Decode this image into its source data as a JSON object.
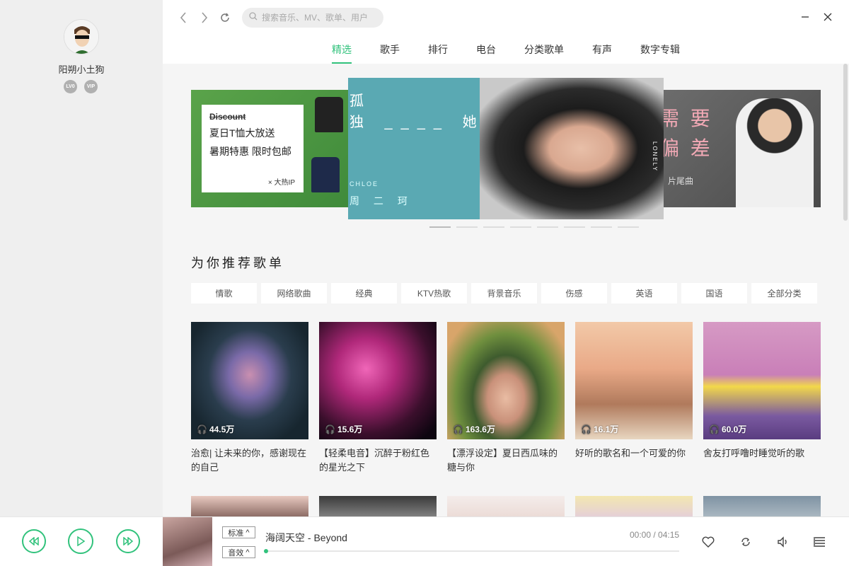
{
  "user": {
    "name": "阳朔小土狗",
    "badges": [
      "LV0",
      "VIP"
    ]
  },
  "search": {
    "placeholder": "搜索音乐、MV、歌单、用户"
  },
  "tabs": [
    "精选",
    "歌手",
    "排行",
    "电台",
    "分类歌单",
    "有声",
    "数字专辑"
  ],
  "active_tab": "精选",
  "banner": {
    "left": {
      "discount": "Discount",
      "line1": "夏日T恤大放送",
      "line2": "暑期特惠 限时包邮",
      "tag": "× 大热IP"
    },
    "center": {
      "title_line1": "孤",
      "title_line2": "独 ____ 她 呀",
      "artist_en": "CHLOE",
      "artist": "周 二 珂",
      "side_text": "LONELY"
    },
    "right": {
      "title_line1": "需 要",
      "title_line2": "偏 差",
      "sub": "》片尾曲"
    },
    "dot_count": 8,
    "active_dot": 0
  },
  "section_title": "为你推荐歌单",
  "categories": [
    "情歌",
    "网络歌曲",
    "经典",
    "KTV热歌",
    "背景音乐",
    "伤感",
    "英语",
    "国语",
    "全部分类"
  ],
  "playlists": [
    {
      "plays": "44.5万",
      "title": "治愈| 让未来的你，感谢现在的自己"
    },
    {
      "plays": "15.6万",
      "title": "【轻柔电音】沉醉于粉红色的星光之下"
    },
    {
      "plays": "163.6万",
      "title": "【漂浮设定】夏日西瓜味的糖与你"
    },
    {
      "plays": "16.1万",
      "title": "好听的歌名和一个可爱的你"
    },
    {
      "plays": "60.0万",
      "title": "舍友打呼噜时睡觉听的歌"
    }
  ],
  "player": {
    "quality": "标准",
    "effect": "音效",
    "song": "海阔天空 - Beyond",
    "time": "00:00 / 04:15",
    "progress": 0
  },
  "colors": {
    "accent": "#31c27c"
  }
}
